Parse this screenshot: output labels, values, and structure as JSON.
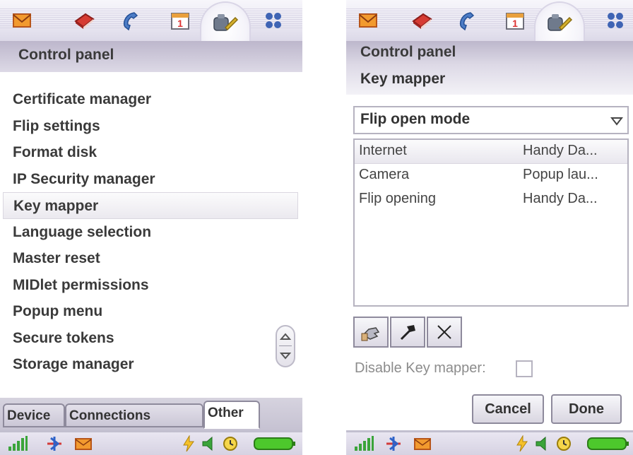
{
  "left_screen": {
    "title": "Control panel",
    "items": [
      {
        "label": "Certificate manager"
      },
      {
        "label": "Flip settings"
      },
      {
        "label": "Format disk"
      },
      {
        "label": "IP Security manager"
      },
      {
        "label": "Key mapper",
        "selected": true
      },
      {
        "label": "Language selection"
      },
      {
        "label": "Master reset"
      },
      {
        "label": "MIDlet permissions"
      },
      {
        "label": "Popup menu"
      },
      {
        "label": "Secure tokens"
      },
      {
        "label": "Storage manager"
      }
    ],
    "tabs": [
      {
        "label": "Device"
      },
      {
        "label": "Connections"
      },
      {
        "label": "Other",
        "active": true
      }
    ]
  },
  "right_screen": {
    "title": "Control panel",
    "subtitle": "Key mapper",
    "mode_select": {
      "value": "Flip open mode"
    },
    "mappings": [
      {
        "key": "Internet",
        "action": "Handy Da...",
        "selected": true
      },
      {
        "key": "Camera",
        "action": "Popup lau..."
      },
      {
        "key": "Flip opening",
        "action": "Handy Da..."
      }
    ],
    "disable_label": "Disable Key mapper:",
    "disable_checked": false,
    "cancel_label": "Cancel",
    "done_label": "Done"
  },
  "top_icons": [
    "envelope-icon",
    "book-icon",
    "phone-icon",
    "calendar-icon",
    "control-panel-icon",
    "apps-grid-icon"
  ],
  "calendar_day": "1",
  "status_icons": [
    "signal-icon",
    "bluetooth-icon",
    "message-icon",
    "charging-icon",
    "speaker-icon",
    "alarm-icon",
    "battery-icon"
  ],
  "colors": {
    "accent": "#4c7cc6",
    "battery": "#4dc82c",
    "title_bar": "#c7c2d4"
  }
}
